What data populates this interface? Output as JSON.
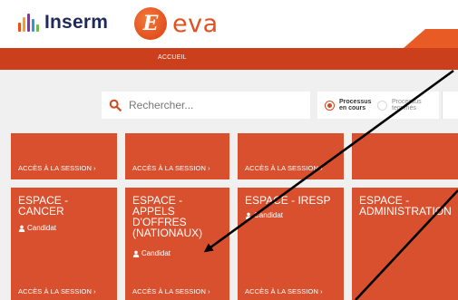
{
  "header": {
    "inserm_logo_text": "Inserm",
    "eva_badge_letter": "E",
    "eva_logo_text": "eva",
    "nav": {
      "accueil": "ACCUEIL"
    }
  },
  "search": {
    "placeholder": "Rechercher..."
  },
  "filter": {
    "options": [
      {
        "line1": "Processus",
        "line2": "en cours",
        "selected": true
      },
      {
        "line1": "Processus",
        "line2": "terminés",
        "selected": false
      }
    ]
  },
  "top_row": {
    "links": [
      "ACCÈS À LA SESSION ›",
      "ACCÈS À LA SESSION ›",
      "ACCÈS À LA SESSION ›"
    ]
  },
  "cards": [
    {
      "title_lines": [
        "ESPACE -",
        "CANCER"
      ],
      "role": "Candidat",
      "link": "ACCÈS À LA SESSION ›"
    },
    {
      "title_lines": [
        "ESPACE -",
        "APPELS",
        "D'OFFRES",
        "(NATIONAUX)"
      ],
      "role": "Candidat",
      "link": "ACCÈS À LA SESSION ›"
    },
    {
      "title_lines": [
        "ESPACE - IRESP"
      ],
      "role": "Candidat",
      "link": "ACCÈS À LA SESSION ›"
    },
    {
      "title_lines": [
        "ESPACE -",
        "ADMINISTRATION"
      ],
      "role": "",
      "link": ""
    }
  ],
  "colors": {
    "accent": "#d8502e",
    "nav_bar": "#cc3f1c",
    "inserm_navy": "#1f2a5c",
    "eva_orange": "#e2501f"
  }
}
